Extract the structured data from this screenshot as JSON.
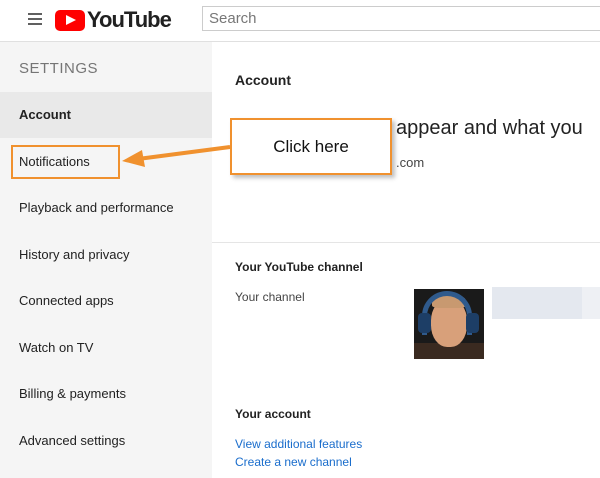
{
  "header": {
    "logo_text": "YouTube",
    "search_placeholder": "Search"
  },
  "sidebar": {
    "title": "SETTINGS",
    "items": [
      {
        "label": "Account"
      },
      {
        "label": "Notifications"
      },
      {
        "label": "Playback and performance"
      },
      {
        "label": "History and privacy"
      },
      {
        "label": "Connected apps"
      },
      {
        "label": "Watch on TV"
      },
      {
        "label": "Billing & payments"
      },
      {
        "label": "Advanced settings"
      }
    ]
  },
  "main": {
    "heading": "Account",
    "partial_text": "appear and what you",
    "partial_email": ".com",
    "channel_heading": "Your YouTube channel",
    "channel_label": "Your channel",
    "account_heading": "Your account",
    "links": [
      "View additional features",
      "Create a new channel"
    ]
  },
  "annotation": {
    "callout_text": "Click here",
    "color": "#f0912e"
  }
}
